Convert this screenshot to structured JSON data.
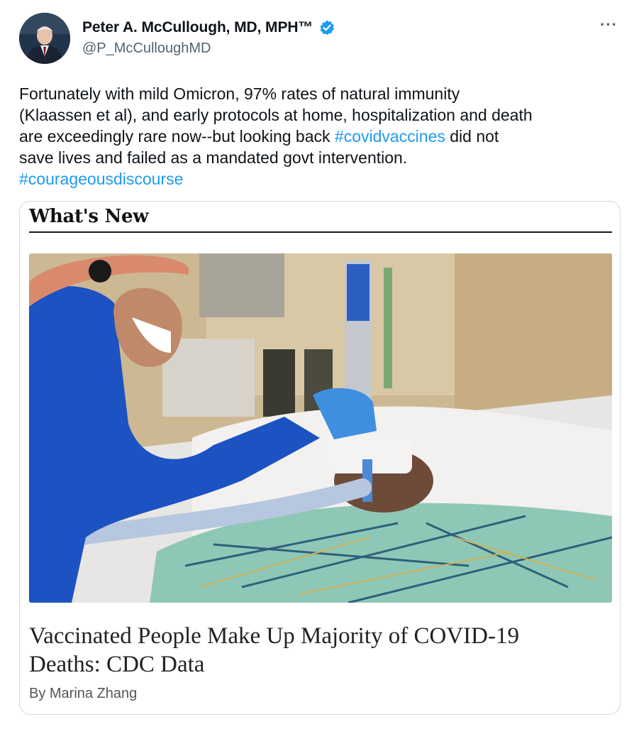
{
  "author": {
    "name": "Peter A. McCullough, MD, MPH™",
    "handle": "@P_McCulloughMD",
    "verified_color": "#1d9bf0"
  },
  "more_label": "···",
  "tweet_text": {
    "line1": "Fortunately with mild Omicron, 97% rates of natural immunity",
    "line2": "(Klaassen et al), and early protocols at home, hospitalization and death",
    "line3_start": "are exceedingly rare now--but looking back ",
    "hashtag1": "#covidvaccines",
    "line3_end": " did not",
    "line4": "save lives and failed as a mandated govt intervention.",
    "hashtag2": "#courageousdiscourse"
  },
  "card": {
    "section_label": "What's New",
    "headline_line1": "Vaccinated People Make Up Majority of COVID-19",
    "headline_line2": "Deaths: CDC Data",
    "byline": "By Marina Zhang"
  },
  "colors": {
    "link": "#1d9bf0",
    "secondary_text": "#536471"
  }
}
